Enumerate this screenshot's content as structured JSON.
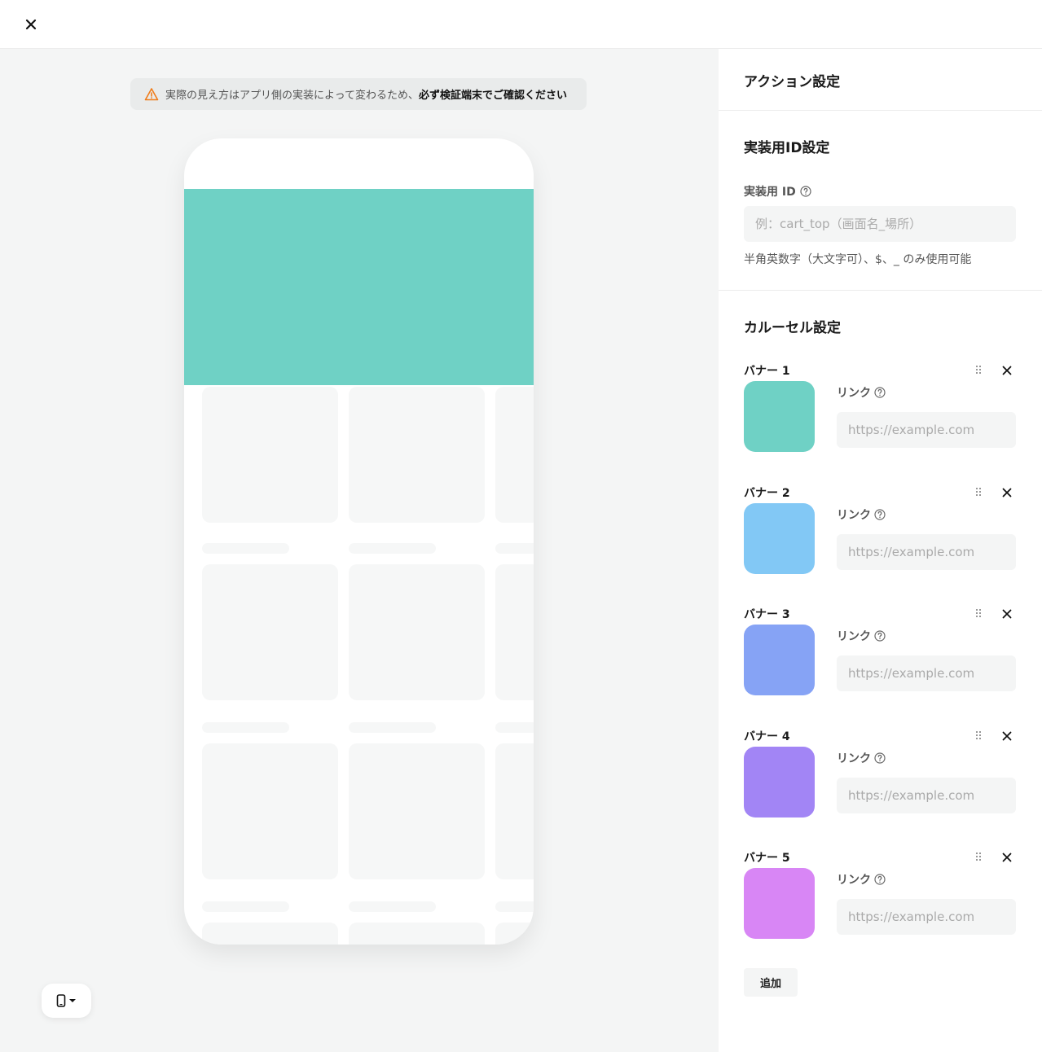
{
  "notice": {
    "text": "実際の見え方はアプリ側の実装によって変わるため、",
    "emphasis": "必ず検証端末でご確認ください"
  },
  "panel": {
    "title": "アクション設定",
    "id_section": {
      "title": "実装用ID設定",
      "label": "実装用 ID",
      "placeholder": "例：cart_top（画面名_場所）",
      "hint": "半角英数字（大文字可）、$、_ のみ使用可能"
    },
    "carousel": {
      "title": "カルーセル設定",
      "link_label": "リンク",
      "link_placeholder": "https://example.com",
      "add_label": "追加",
      "banners": [
        {
          "name": "バナー 1",
          "color": "#6fd1c5"
        },
        {
          "name": "バナー 2",
          "color": "#82c8f5"
        },
        {
          "name": "バナー 3",
          "color": "#86a3f5"
        },
        {
          "name": "バナー 4",
          "color": "#a285f5"
        },
        {
          "name": "バナー 5",
          "color": "#d886f5"
        }
      ]
    }
  },
  "preview": {
    "banner_color": "#6fd1c5"
  },
  "icons": {
    "close": "close-icon",
    "warning": "warning-icon",
    "help": "help-circle-icon",
    "drag": "drag-handle-icon",
    "device": "mobile-device-icon",
    "chevron": "chevron-down-icon"
  }
}
